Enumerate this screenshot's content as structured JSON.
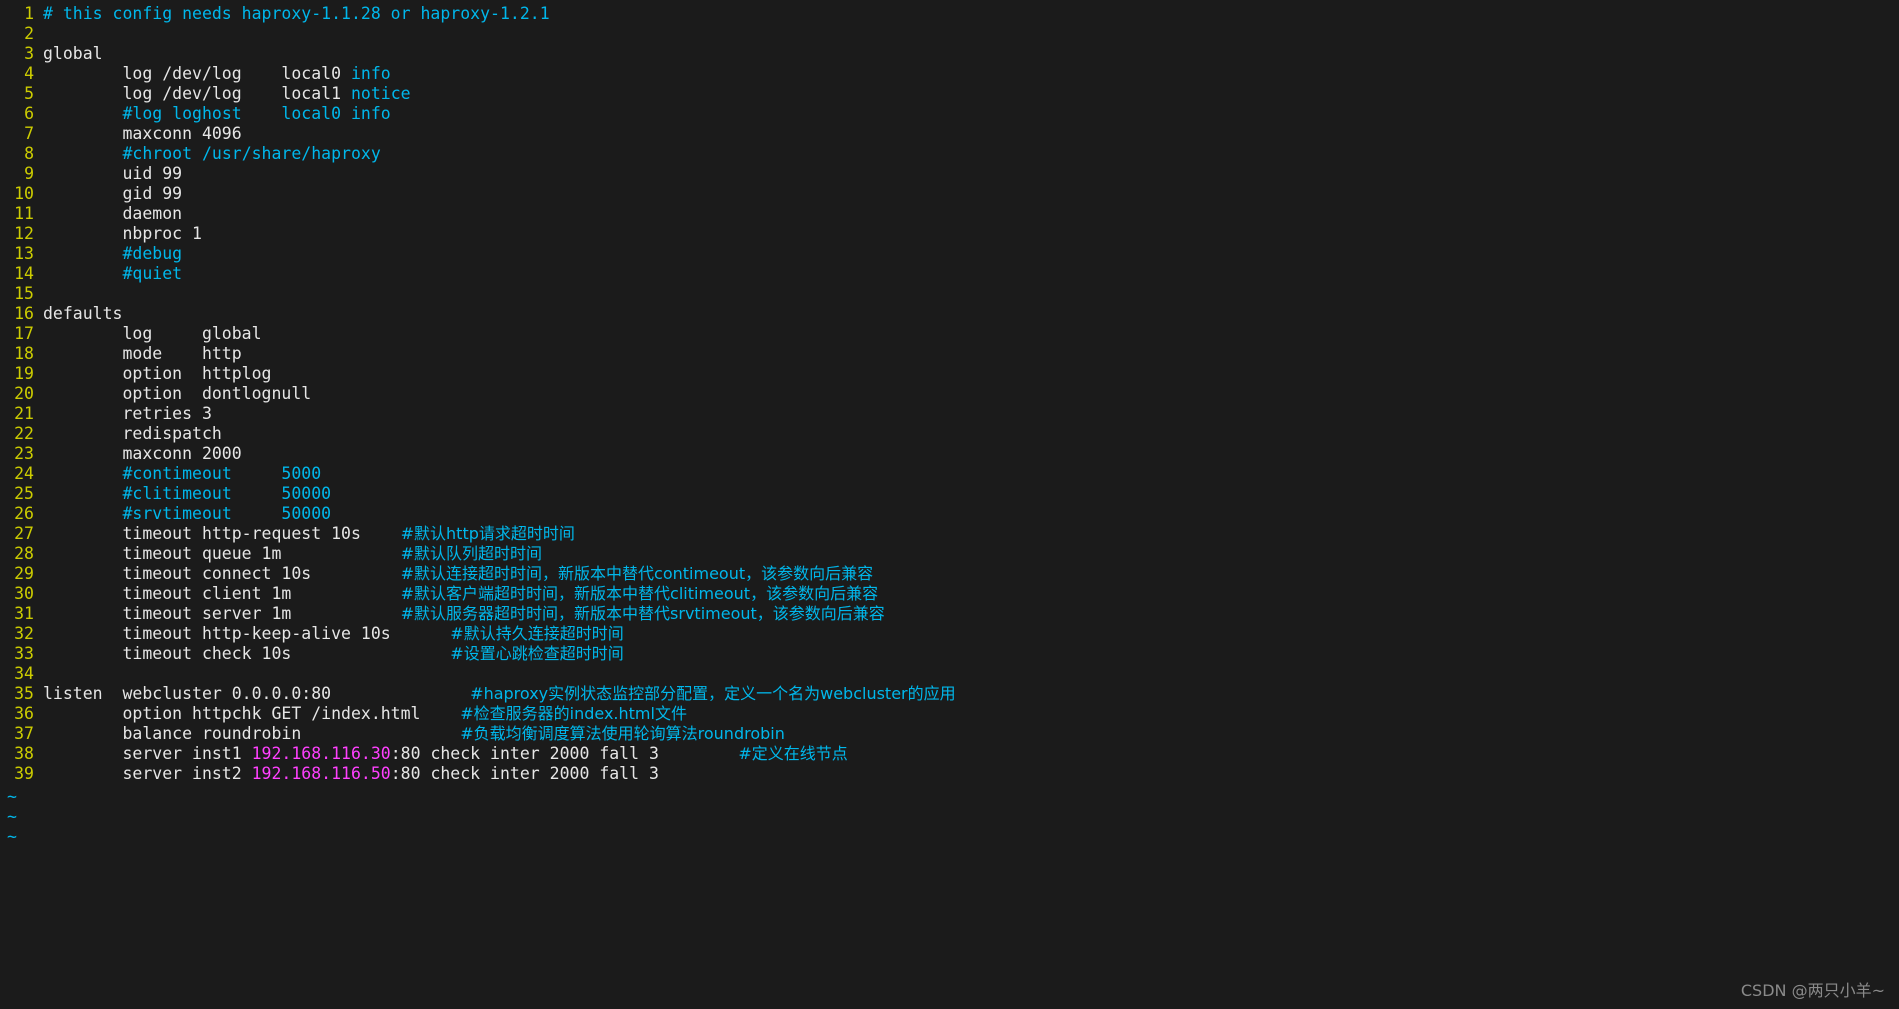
{
  "editor": {
    "name": "vim",
    "background_color": "#1b1b1b",
    "line_number_color": "#cdcd00",
    "comment_color": "#00b7eb",
    "ip_color": "#ff40ff",
    "text_color": "#e6e6e6",
    "empty_line_marker": "~",
    "empty_line_markers": [
      "~",
      "~",
      "~"
    ]
  },
  "watermark": "CSDN @两只小羊~",
  "file": {
    "lines": [
      {
        "num": "1",
        "segments": [
          {
            "t": "# this config needs haproxy-1.1.28 or haproxy-1.2.1",
            "c": "cm"
          }
        ]
      },
      {
        "num": "2",
        "segments": []
      },
      {
        "num": "3",
        "segments": [
          {
            "t": "global",
            "c": "kw"
          }
        ]
      },
      {
        "num": "4",
        "segments": [
          {
            "t": "        log /dev/log    local0 ",
            "c": "kw"
          },
          {
            "t": "info",
            "c": "cm"
          }
        ]
      },
      {
        "num": "5",
        "segments": [
          {
            "t": "        log /dev/log    local1 ",
            "c": "kw"
          },
          {
            "t": "notice",
            "c": "cm"
          }
        ]
      },
      {
        "num": "6",
        "segments": [
          {
            "t": "        ",
            "c": "kw"
          },
          {
            "t": "#log loghost    local0 info",
            "c": "cm"
          }
        ]
      },
      {
        "num": "7",
        "segments": [
          {
            "t": "        maxconn 4096",
            "c": "kw"
          }
        ]
      },
      {
        "num": "8",
        "segments": [
          {
            "t": "        ",
            "c": "kw"
          },
          {
            "t": "#chroot /usr/share/haproxy",
            "c": "cm"
          }
        ]
      },
      {
        "num": "9",
        "segments": [
          {
            "t": "        uid 99",
            "c": "kw"
          }
        ]
      },
      {
        "num": "10",
        "segments": [
          {
            "t": "        gid 99",
            "c": "kw"
          }
        ]
      },
      {
        "num": "11",
        "segments": [
          {
            "t": "        daemon",
            "c": "kw"
          }
        ]
      },
      {
        "num": "12",
        "segments": [
          {
            "t": "        nbproc 1",
            "c": "kw"
          }
        ]
      },
      {
        "num": "13",
        "segments": [
          {
            "t": "        ",
            "c": "kw"
          },
          {
            "t": "#debug",
            "c": "cm"
          }
        ]
      },
      {
        "num": "14",
        "segments": [
          {
            "t": "        ",
            "c": "kw"
          },
          {
            "t": "#quiet",
            "c": "cm"
          }
        ]
      },
      {
        "num": "15",
        "segments": []
      },
      {
        "num": "16",
        "segments": [
          {
            "t": "defaults",
            "c": "kw"
          }
        ]
      },
      {
        "num": "17",
        "segments": [
          {
            "t": "        log     global",
            "c": "kw"
          }
        ]
      },
      {
        "num": "18",
        "segments": [
          {
            "t": "        mode    http",
            "c": "kw"
          }
        ]
      },
      {
        "num": "19",
        "segments": [
          {
            "t": "        option  httplog",
            "c": "kw"
          }
        ]
      },
      {
        "num": "20",
        "segments": [
          {
            "t": "        option  dontlognull",
            "c": "kw"
          }
        ]
      },
      {
        "num": "21",
        "segments": [
          {
            "t": "        retries 3",
            "c": "kw"
          }
        ]
      },
      {
        "num": "22",
        "segments": [
          {
            "t": "        redispatch",
            "c": "kw"
          }
        ]
      },
      {
        "num": "23",
        "segments": [
          {
            "t": "        maxconn 2000",
            "c": "kw"
          }
        ]
      },
      {
        "num": "24",
        "segments": [
          {
            "t": "        ",
            "c": "kw"
          },
          {
            "t": "#contimeout     5000",
            "c": "cm"
          }
        ]
      },
      {
        "num": "25",
        "segments": [
          {
            "t": "        ",
            "c": "kw"
          },
          {
            "t": "#clitimeout     50000",
            "c": "cm"
          }
        ]
      },
      {
        "num": "26",
        "segments": [
          {
            "t": "        ",
            "c": "kw"
          },
          {
            "t": "#srvtimeout     50000",
            "c": "cm"
          }
        ]
      },
      {
        "num": "27",
        "segments": [
          {
            "t": "        timeout http-request 10s    ",
            "c": "kw"
          },
          {
            "t": "#默认http请求超时时间",
            "c": "cmcn"
          }
        ]
      },
      {
        "num": "28",
        "segments": [
          {
            "t": "        timeout queue 1m            ",
            "c": "kw"
          },
          {
            "t": "#默认队列超时时间",
            "c": "cmcn"
          }
        ]
      },
      {
        "num": "29",
        "segments": [
          {
            "t": "        timeout connect 10s         ",
            "c": "kw"
          },
          {
            "t": "#默认连接超时时间，新版本中替代contimeout，该参数向后兼容",
            "c": "cmcn"
          }
        ]
      },
      {
        "num": "30",
        "segments": [
          {
            "t": "        timeout client 1m           ",
            "c": "kw"
          },
          {
            "t": "#默认客户端超时时间，新版本中替代clitimeout，该参数向后兼容",
            "c": "cmcn"
          }
        ]
      },
      {
        "num": "31",
        "segments": [
          {
            "t": "        timeout server 1m           ",
            "c": "kw"
          },
          {
            "t": "#默认服务器超时时间，新版本中替代srvtimeout，该参数向后兼容",
            "c": "cmcn"
          }
        ]
      },
      {
        "num": "32",
        "segments": [
          {
            "t": "        timeout http-keep-alive 10s      ",
            "c": "kw"
          },
          {
            "t": "#默认持久连接超时时间",
            "c": "cmcn"
          }
        ]
      },
      {
        "num": "33",
        "segments": [
          {
            "t": "        timeout check 10s                ",
            "c": "kw"
          },
          {
            "t": "#设置心跳检查超时时间",
            "c": "cmcn"
          }
        ]
      },
      {
        "num": "34",
        "segments": []
      },
      {
        "num": "35",
        "segments": [
          {
            "t": "listen  webcluster 0.0.0.0:80              ",
            "c": "kw"
          },
          {
            "t": "#haproxy实例状态监控部分配置，定义一个名为webcluster的应用",
            "c": "cmcn"
          }
        ]
      },
      {
        "num": "36",
        "segments": [
          {
            "t": "        option httpchk GET /index.html    ",
            "c": "kw"
          },
          {
            "t": "#检查服务器的index.html文件",
            "c": "cmcn"
          }
        ]
      },
      {
        "num": "37",
        "segments": [
          {
            "t": "        balance roundrobin                ",
            "c": "kw"
          },
          {
            "t": "#负载均衡调度算法使用轮询算法roundrobin",
            "c": "cmcn"
          }
        ]
      },
      {
        "num": "38",
        "segments": [
          {
            "t": "        server inst1 ",
            "c": "kw"
          },
          {
            "t": "192.168.116.30",
            "c": "ip"
          },
          {
            "t": ":80 check inter 2000 fall 3        ",
            "c": "kw"
          },
          {
            "t": "#定义在线节点",
            "c": "cmcn"
          }
        ]
      },
      {
        "num": "39",
        "segments": [
          {
            "t": "        server inst2 ",
            "c": "kw"
          },
          {
            "t": "192.168.116.50",
            "c": "ip"
          },
          {
            "t": ":80 check inter 2000 fall 3",
            "c": "kw"
          }
        ]
      }
    ]
  }
}
